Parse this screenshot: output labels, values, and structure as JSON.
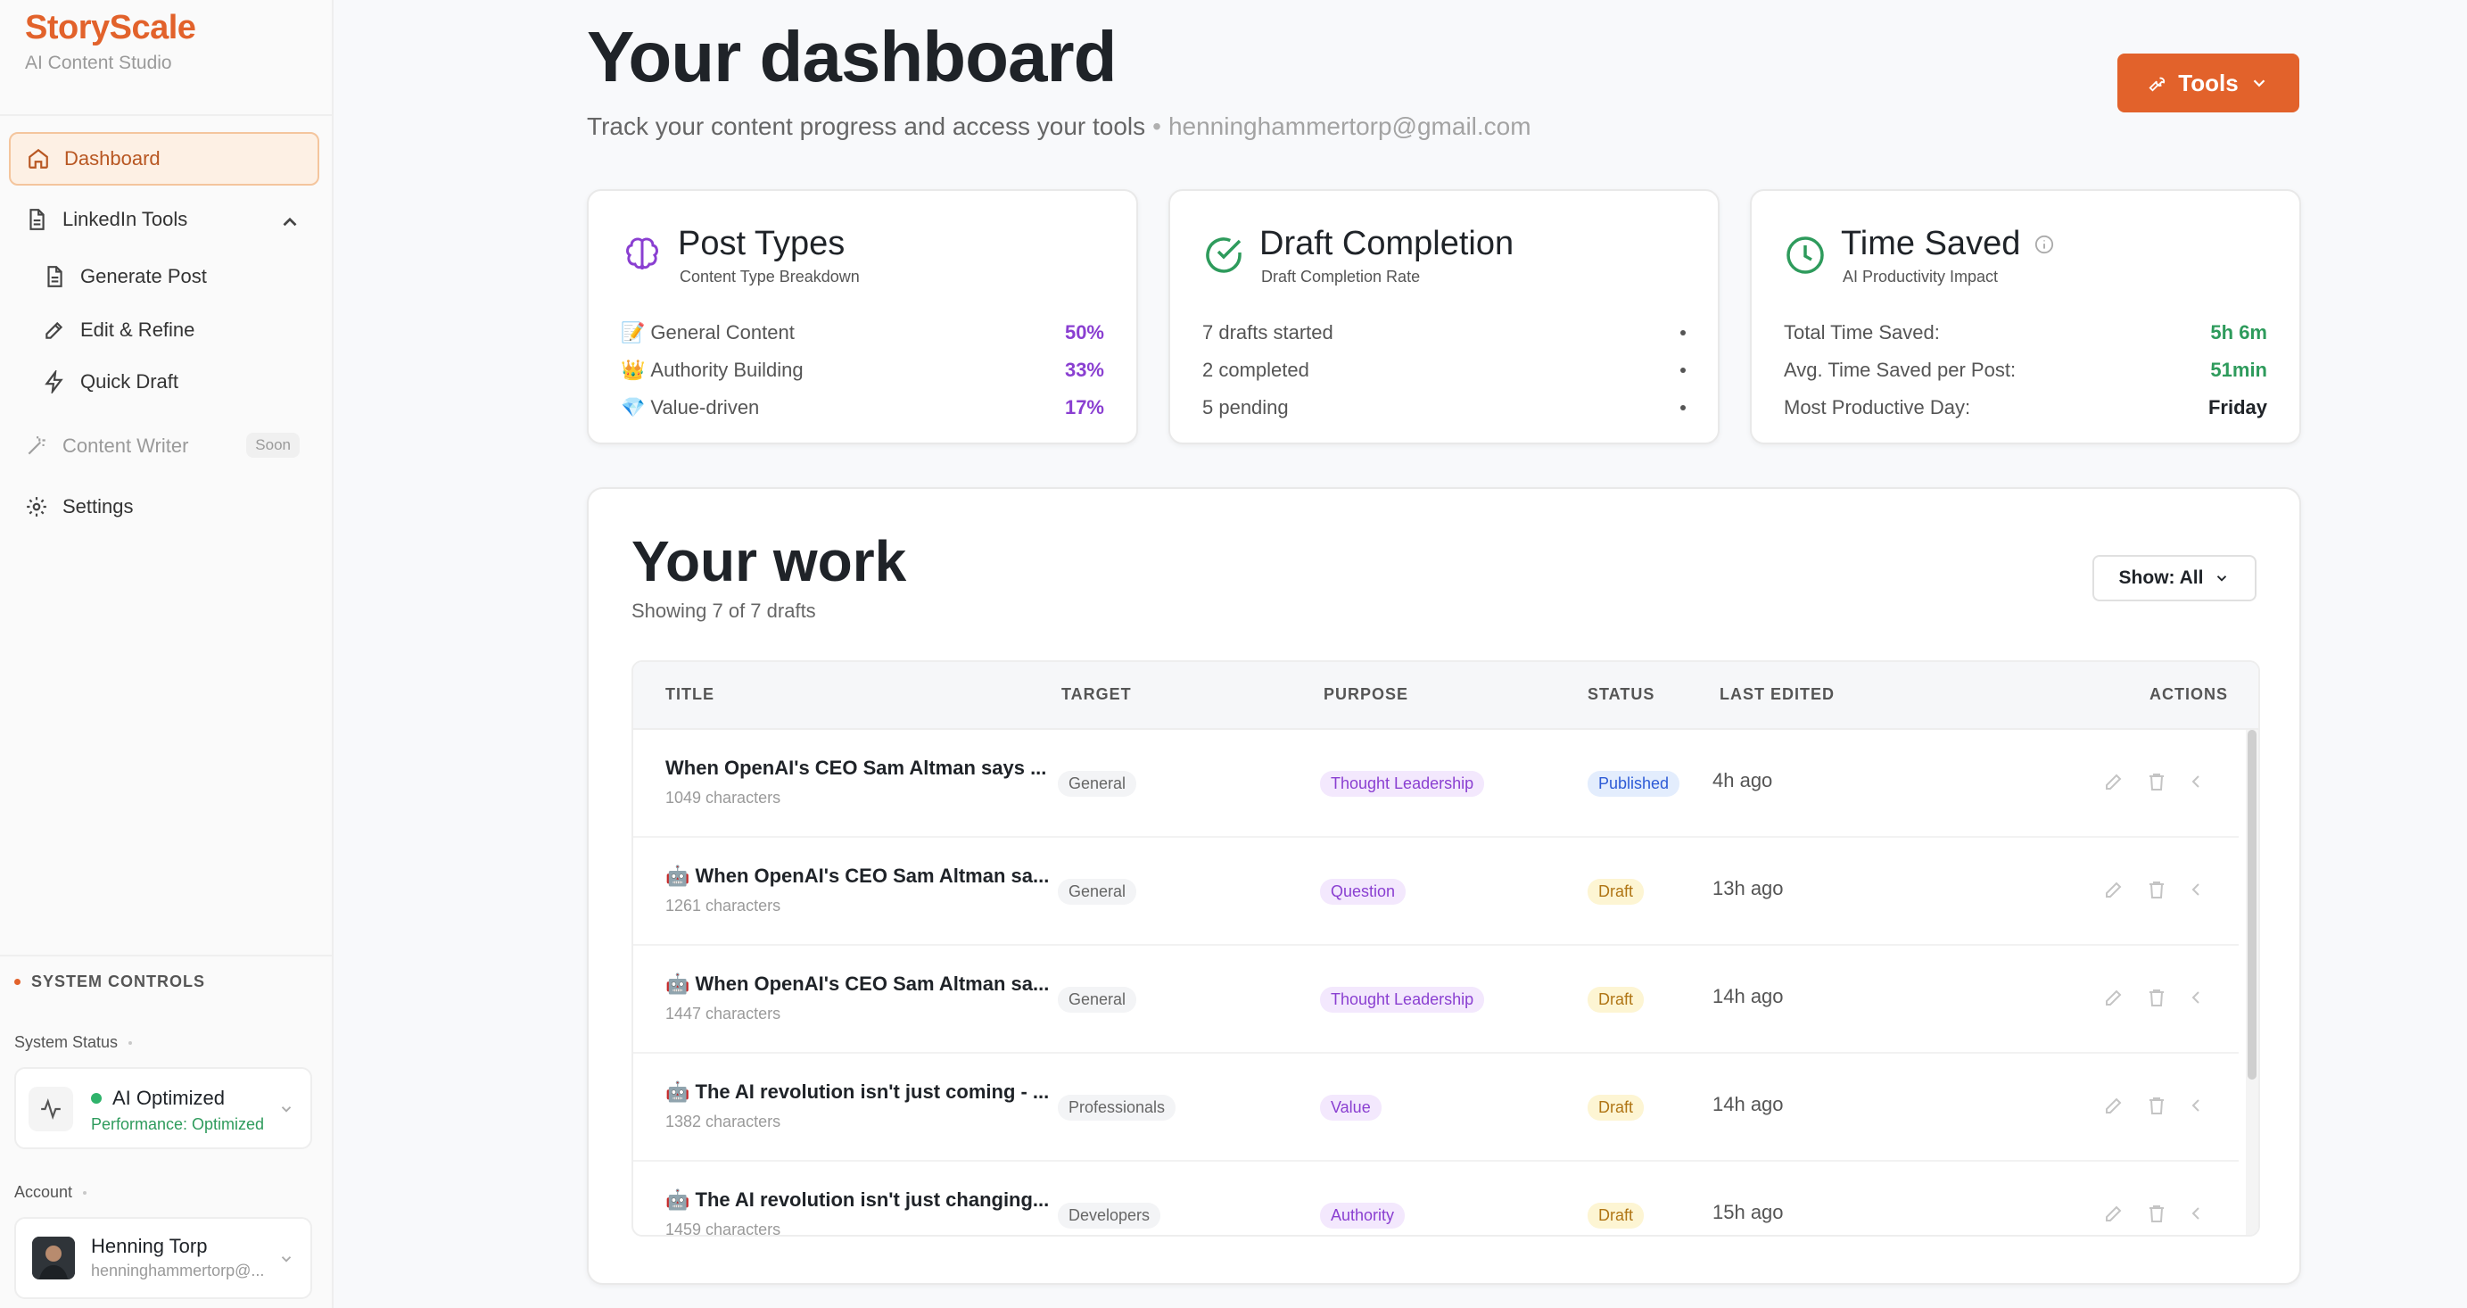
{
  "brand": {
    "title": "StoryScale",
    "subtitle": "AI Content Studio"
  },
  "nav": {
    "dashboard": "Dashboard",
    "linkedin_tools": "LinkedIn Tools",
    "generate_post": "Generate Post",
    "edit_refine": "Edit & Refine",
    "quick_draft": "Quick Draft",
    "content_writer": "Content Writer",
    "soon_badge": "Soon",
    "settings": "Settings"
  },
  "system": {
    "heading": "SYSTEM CONTROLS",
    "status_label": "System Status",
    "status_title": "AI Optimized",
    "status_sub": "Performance: Optimized",
    "account_label": "Account",
    "account_name": "Henning Torp",
    "account_email": "henninghammertorp@..."
  },
  "header": {
    "title": "Your dashboard",
    "subtitle": "Track your content progress and access your tools",
    "email": "henninghammertorp@gmail.com",
    "tools_button": "Tools"
  },
  "cards": {
    "post_types": {
      "title": "Post Types",
      "subtitle": "Content Type Breakdown",
      "rows": [
        {
          "emoji": "📝",
          "label": "General Content",
          "value": "50%"
        },
        {
          "emoji": "👑",
          "label": "Authority Building",
          "value": "33%"
        },
        {
          "emoji": "💎",
          "label": "Value-driven",
          "value": "17%"
        }
      ]
    },
    "draft_completion": {
      "title": "Draft Completion",
      "subtitle": "Draft Completion Rate",
      "rows": [
        {
          "label": "7 drafts started"
        },
        {
          "label": "2 completed"
        },
        {
          "label": "5 pending"
        }
      ]
    },
    "time_saved": {
      "title": "Time Saved",
      "subtitle": "AI Productivity Impact",
      "rows": [
        {
          "label": "Total Time Saved:",
          "value": "5h 6m"
        },
        {
          "label": "Avg. Time Saved per Post:",
          "value": "51min"
        },
        {
          "label": "Most Productive Day:",
          "value": "Friday"
        }
      ]
    }
  },
  "work": {
    "title": "Your work",
    "subtitle": "Showing 7 of 7 drafts",
    "filter_label": "Show: All",
    "columns": [
      "TITLE",
      "TARGET",
      "PURPOSE",
      "STATUS",
      "LAST EDITED",
      "ACTIONS"
    ],
    "rows": [
      {
        "title": "When OpenAI's CEO Sam Altman says ...",
        "chars": "1049 characters",
        "target": "General",
        "purpose": "Thought Leadership",
        "status": "Published",
        "edited": "4h ago"
      },
      {
        "title": "🤖 When OpenAI's CEO Sam Altman sa...",
        "chars": "1261 characters",
        "target": "General",
        "purpose": "Question",
        "status": "Draft",
        "edited": "13h ago"
      },
      {
        "title": "🤖 When OpenAI's CEO Sam Altman sa...",
        "chars": "1447 characters",
        "target": "General",
        "purpose": "Thought Leadership",
        "status": "Draft",
        "edited": "14h ago"
      },
      {
        "title": "🤖 The AI revolution isn't just coming - ...",
        "chars": "1382 characters",
        "target": "Professionals",
        "purpose": "Value",
        "status": "Draft",
        "edited": "14h ago"
      },
      {
        "title": "🤖 The AI revolution isn't just changing...",
        "chars": "1459 characters",
        "target": "Developers",
        "purpose": "Authority",
        "status": "Draft",
        "edited": "15h ago"
      }
    ]
  },
  "colors": {
    "brand": "#e2622b",
    "purple": "#8a3fd1",
    "green": "#2e9b5c",
    "published_blue": "#2d5bd6",
    "draft_amber": "#b07514"
  }
}
